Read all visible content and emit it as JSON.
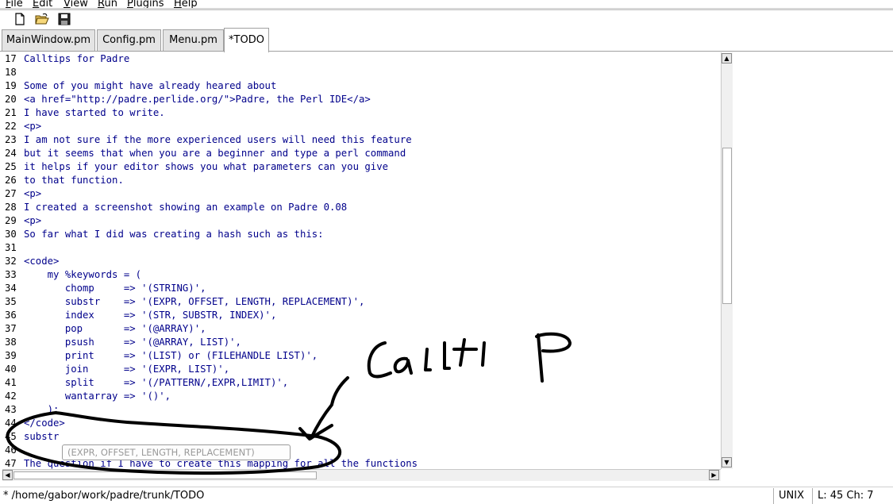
{
  "menubar": {
    "items": [
      {
        "label": "File",
        "mnemonic": "F"
      },
      {
        "label": "Edit",
        "mnemonic": "E"
      },
      {
        "label": "View",
        "mnemonic": "V"
      },
      {
        "label": "Run",
        "mnemonic": "R"
      },
      {
        "label": "Plugins",
        "mnemonic": "P"
      },
      {
        "label": "Help",
        "mnemonic": "H"
      }
    ]
  },
  "toolbar": {
    "buttons": [
      {
        "icon": "new-file-icon"
      },
      {
        "icon": "open-folder-icon"
      },
      {
        "icon": "save-icon"
      }
    ]
  },
  "tabs": [
    {
      "label": "MainWindow.pm",
      "active": false
    },
    {
      "label": "Config.pm",
      "active": false
    },
    {
      "label": "Menu.pm",
      "active": false
    },
    {
      "label": "*TODO",
      "active": true
    }
  ],
  "editor": {
    "lines": [
      {
        "num": "17",
        "text": "Calltips for Padre"
      },
      {
        "num": "18",
        "text": ""
      },
      {
        "num": "19",
        "text": "Some of you might have already heared about"
      },
      {
        "num": "20",
        "text": "<a href=\"http://padre.perlide.org/\">Padre, the Perl IDE</a>"
      },
      {
        "num": "21",
        "text": "I have started to write."
      },
      {
        "num": "22",
        "text": "<p>"
      },
      {
        "num": "23",
        "text": "I am not sure if the more experienced users will need this feature"
      },
      {
        "num": "24",
        "text": "but it seems that when you are a beginner and type a perl command"
      },
      {
        "num": "25",
        "text": "it helps if your editor shows you what parameters can you give"
      },
      {
        "num": "26",
        "text": "to that function."
      },
      {
        "num": "27",
        "text": "<p>"
      },
      {
        "num": "28",
        "text": "I created a screenshot showing an example on Padre 0.08"
      },
      {
        "num": "29",
        "text": "<p>"
      },
      {
        "num": "30",
        "text": "So far what I did was creating a hash such as this:"
      },
      {
        "num": "31",
        "text": ""
      },
      {
        "num": "32",
        "text": "<code>"
      },
      {
        "num": "33",
        "text": "    my %keywords = ("
      },
      {
        "num": "34",
        "text": "       chomp     => '(STRING)',"
      },
      {
        "num": "35",
        "text": "       substr    => '(EXPR, OFFSET, LENGTH, REPLACEMENT)',"
      },
      {
        "num": "36",
        "text": "       index     => '(STR, SUBSTR, INDEX)',"
      },
      {
        "num": "37",
        "text": "       pop       => '(@ARRAY)',"
      },
      {
        "num": "38",
        "text": "       psush     => '(@ARRAY, LIST)',"
      },
      {
        "num": "39",
        "text": "       print     => '(LIST) or (FILEHANDLE LIST)',"
      },
      {
        "num": "40",
        "text": "       join      => '(EXPR, LIST)',"
      },
      {
        "num": "41",
        "text": "       split     => '(/PATTERN/,EXPR,LIMIT)',"
      },
      {
        "num": "42",
        "text": "       wantarray => '()',"
      },
      {
        "num": "43",
        "text": "    );"
      },
      {
        "num": "44",
        "text": "</code>"
      },
      {
        "num": "45",
        "text": "substr"
      },
      {
        "num": "46",
        "text": ""
      },
      {
        "num": "47",
        "text": "The question if I have to create this mapping for all the functions"
      }
    ],
    "calltip": "(EXPR, OFFSET, LENGTH, REPLACEMENT)"
  },
  "annotation": {
    "text": "Calltip"
  },
  "statusbar": {
    "path": "* /home/gabor/work/padre/trunk/TODO",
    "newline": "UNIX",
    "position": "L: 45 Ch: 7"
  },
  "colors": {
    "code_text": "#00008b",
    "line_number": "#000000",
    "calltip_text": "#9a9a9a",
    "annotation_ink": "#000000"
  }
}
